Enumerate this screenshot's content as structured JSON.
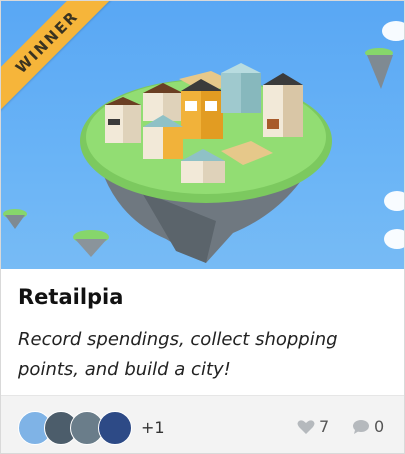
{
  "card": {
    "badge": "WINNER",
    "title": "Retailpia",
    "description": "Record spendings, collect shopping points, and build a city!"
  },
  "footer": {
    "more_members": "+1",
    "likes": "7",
    "comments": "0"
  },
  "colors": {
    "sky": "#5ea9f4",
    "badge": "#f6b53a",
    "island_grass": "#86d66b",
    "footer_bg": "#f3f3f3",
    "icon_gray": "#b5b9bd"
  },
  "icons": [
    "heart-icon",
    "comment-icon"
  ]
}
